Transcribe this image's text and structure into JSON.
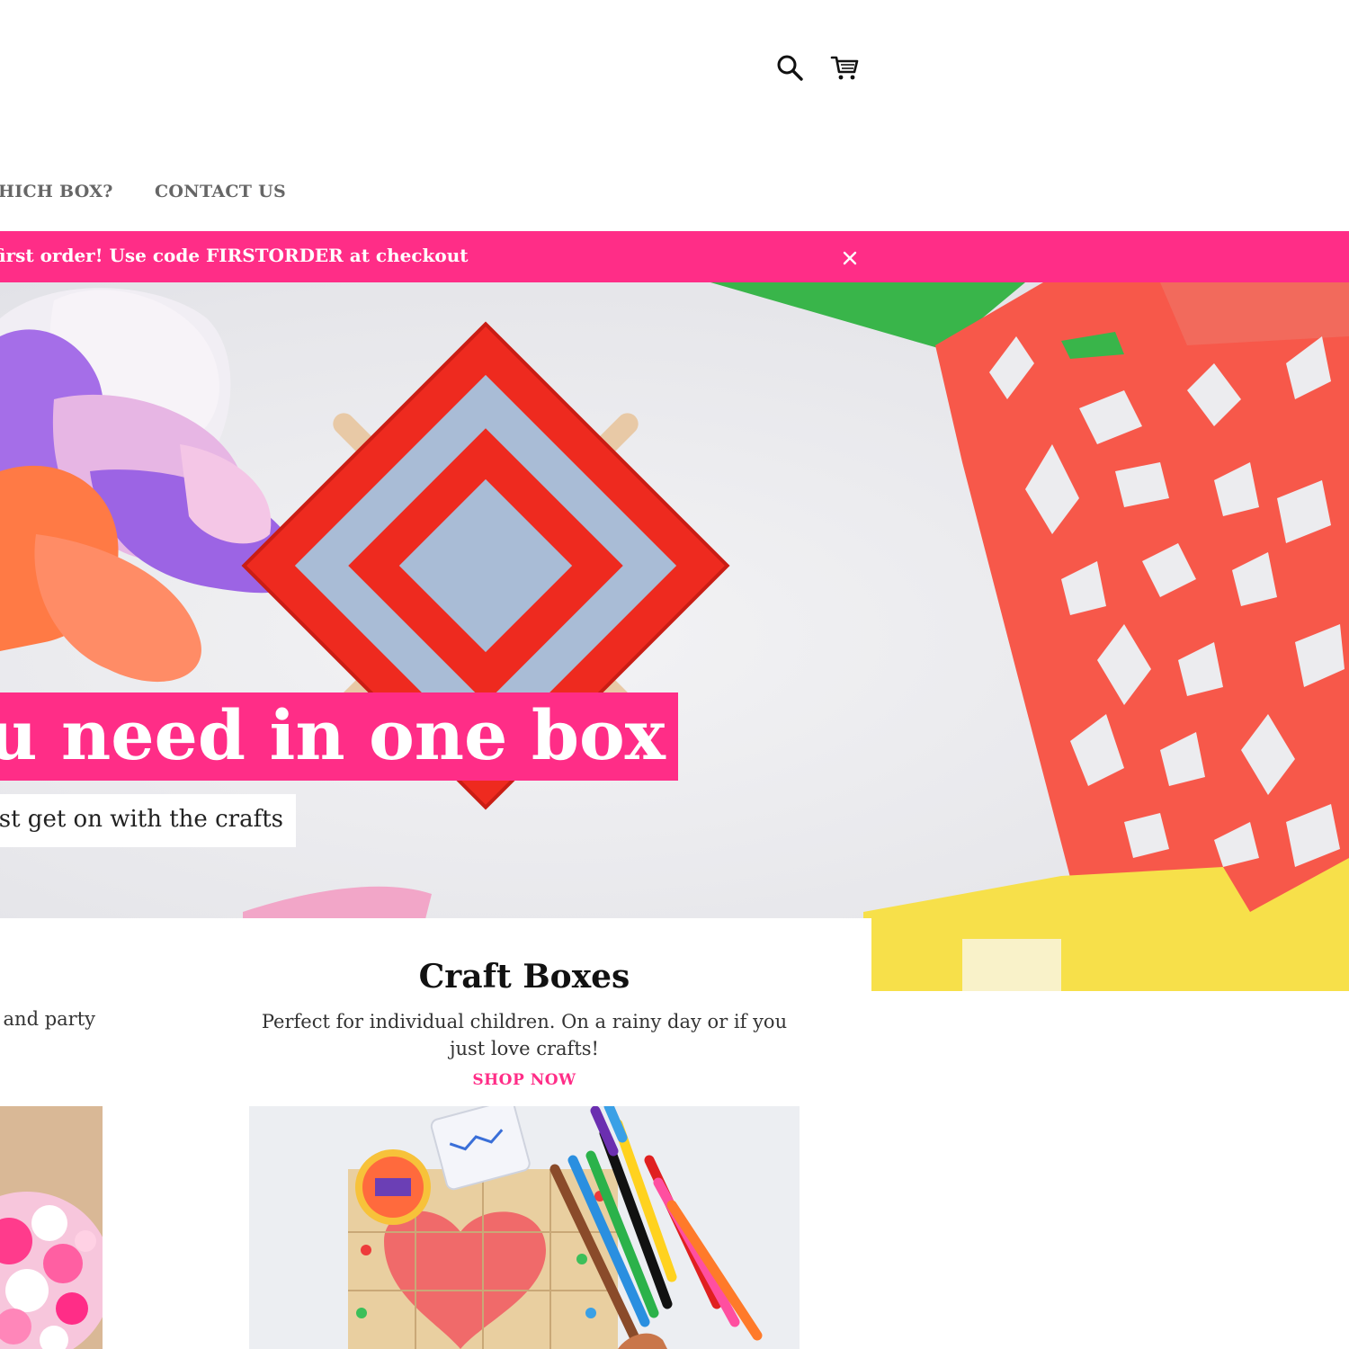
{
  "header": {
    "icons": [
      "search-icon",
      "cart-icon"
    ]
  },
  "nav": {
    "items": [
      {
        "label": "HICH BOX?"
      },
      {
        "label": "CONTACT US"
      }
    ]
  },
  "announcement": {
    "text": "ur first order! Use code FIRSTORDER at checkout",
    "close_icon": "close-icon"
  },
  "hero": {
    "title": "ou need in one box",
    "subtitle": "ust get on with the crafts"
  },
  "collections": {
    "left_fragment": {
      "description": "and party"
    },
    "craft_boxes": {
      "title": "Craft Boxes",
      "description": "Perfect for individual children. On a rainy day or if you just love crafts!",
      "link": "SHOP NOW"
    }
  },
  "colors": {
    "accent": "#ff2d87",
    "nav_text": "#666666",
    "text": "#222222"
  }
}
